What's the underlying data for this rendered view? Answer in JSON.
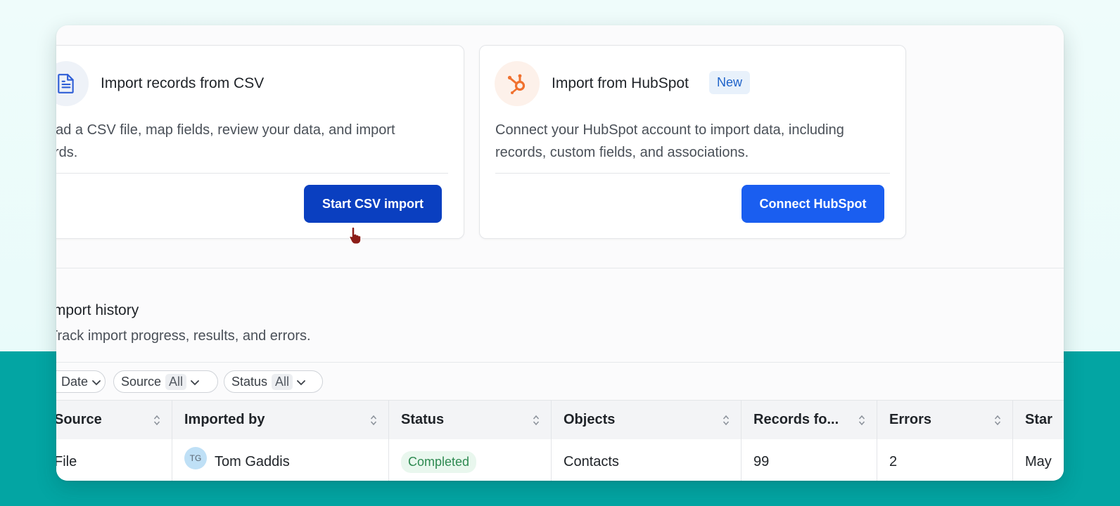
{
  "csv_card": {
    "icon": "document-icon",
    "title": "Import records from CSV",
    "description": "Upload a CSV file, map fields, review your data, and import records.",
    "button_label": "Start CSV import",
    "accent": "#0a3fc0"
  },
  "hubspot_card": {
    "icon": "hubspot-icon",
    "title": "Import from HubSpot",
    "badge": "New",
    "description": "Connect your HubSpot account to import data, including records, custom fields, and associations.",
    "button_label": "Connect HubSpot",
    "accent": "#1a5ef0",
    "icon_color": "#f0712f"
  },
  "history": {
    "title": "Import history",
    "subtitle": "Track import progress, results, and errors."
  },
  "filters": {
    "date": {
      "label": "Date"
    },
    "source": {
      "label": "Source",
      "value": "All"
    },
    "status": {
      "label": "Status",
      "value": "All"
    }
  },
  "table": {
    "columns": [
      "Source",
      "Imported by",
      "Status",
      "Objects",
      "Records fo...",
      "Errors",
      "Star"
    ],
    "rows": [
      {
        "source": "File",
        "imported_by": {
          "initials": "TG",
          "name": "Tom Gaddis"
        },
        "status": "Completed",
        "objects": "Contacts",
        "records": "99",
        "errors": "2",
        "started": "May"
      }
    ]
  }
}
